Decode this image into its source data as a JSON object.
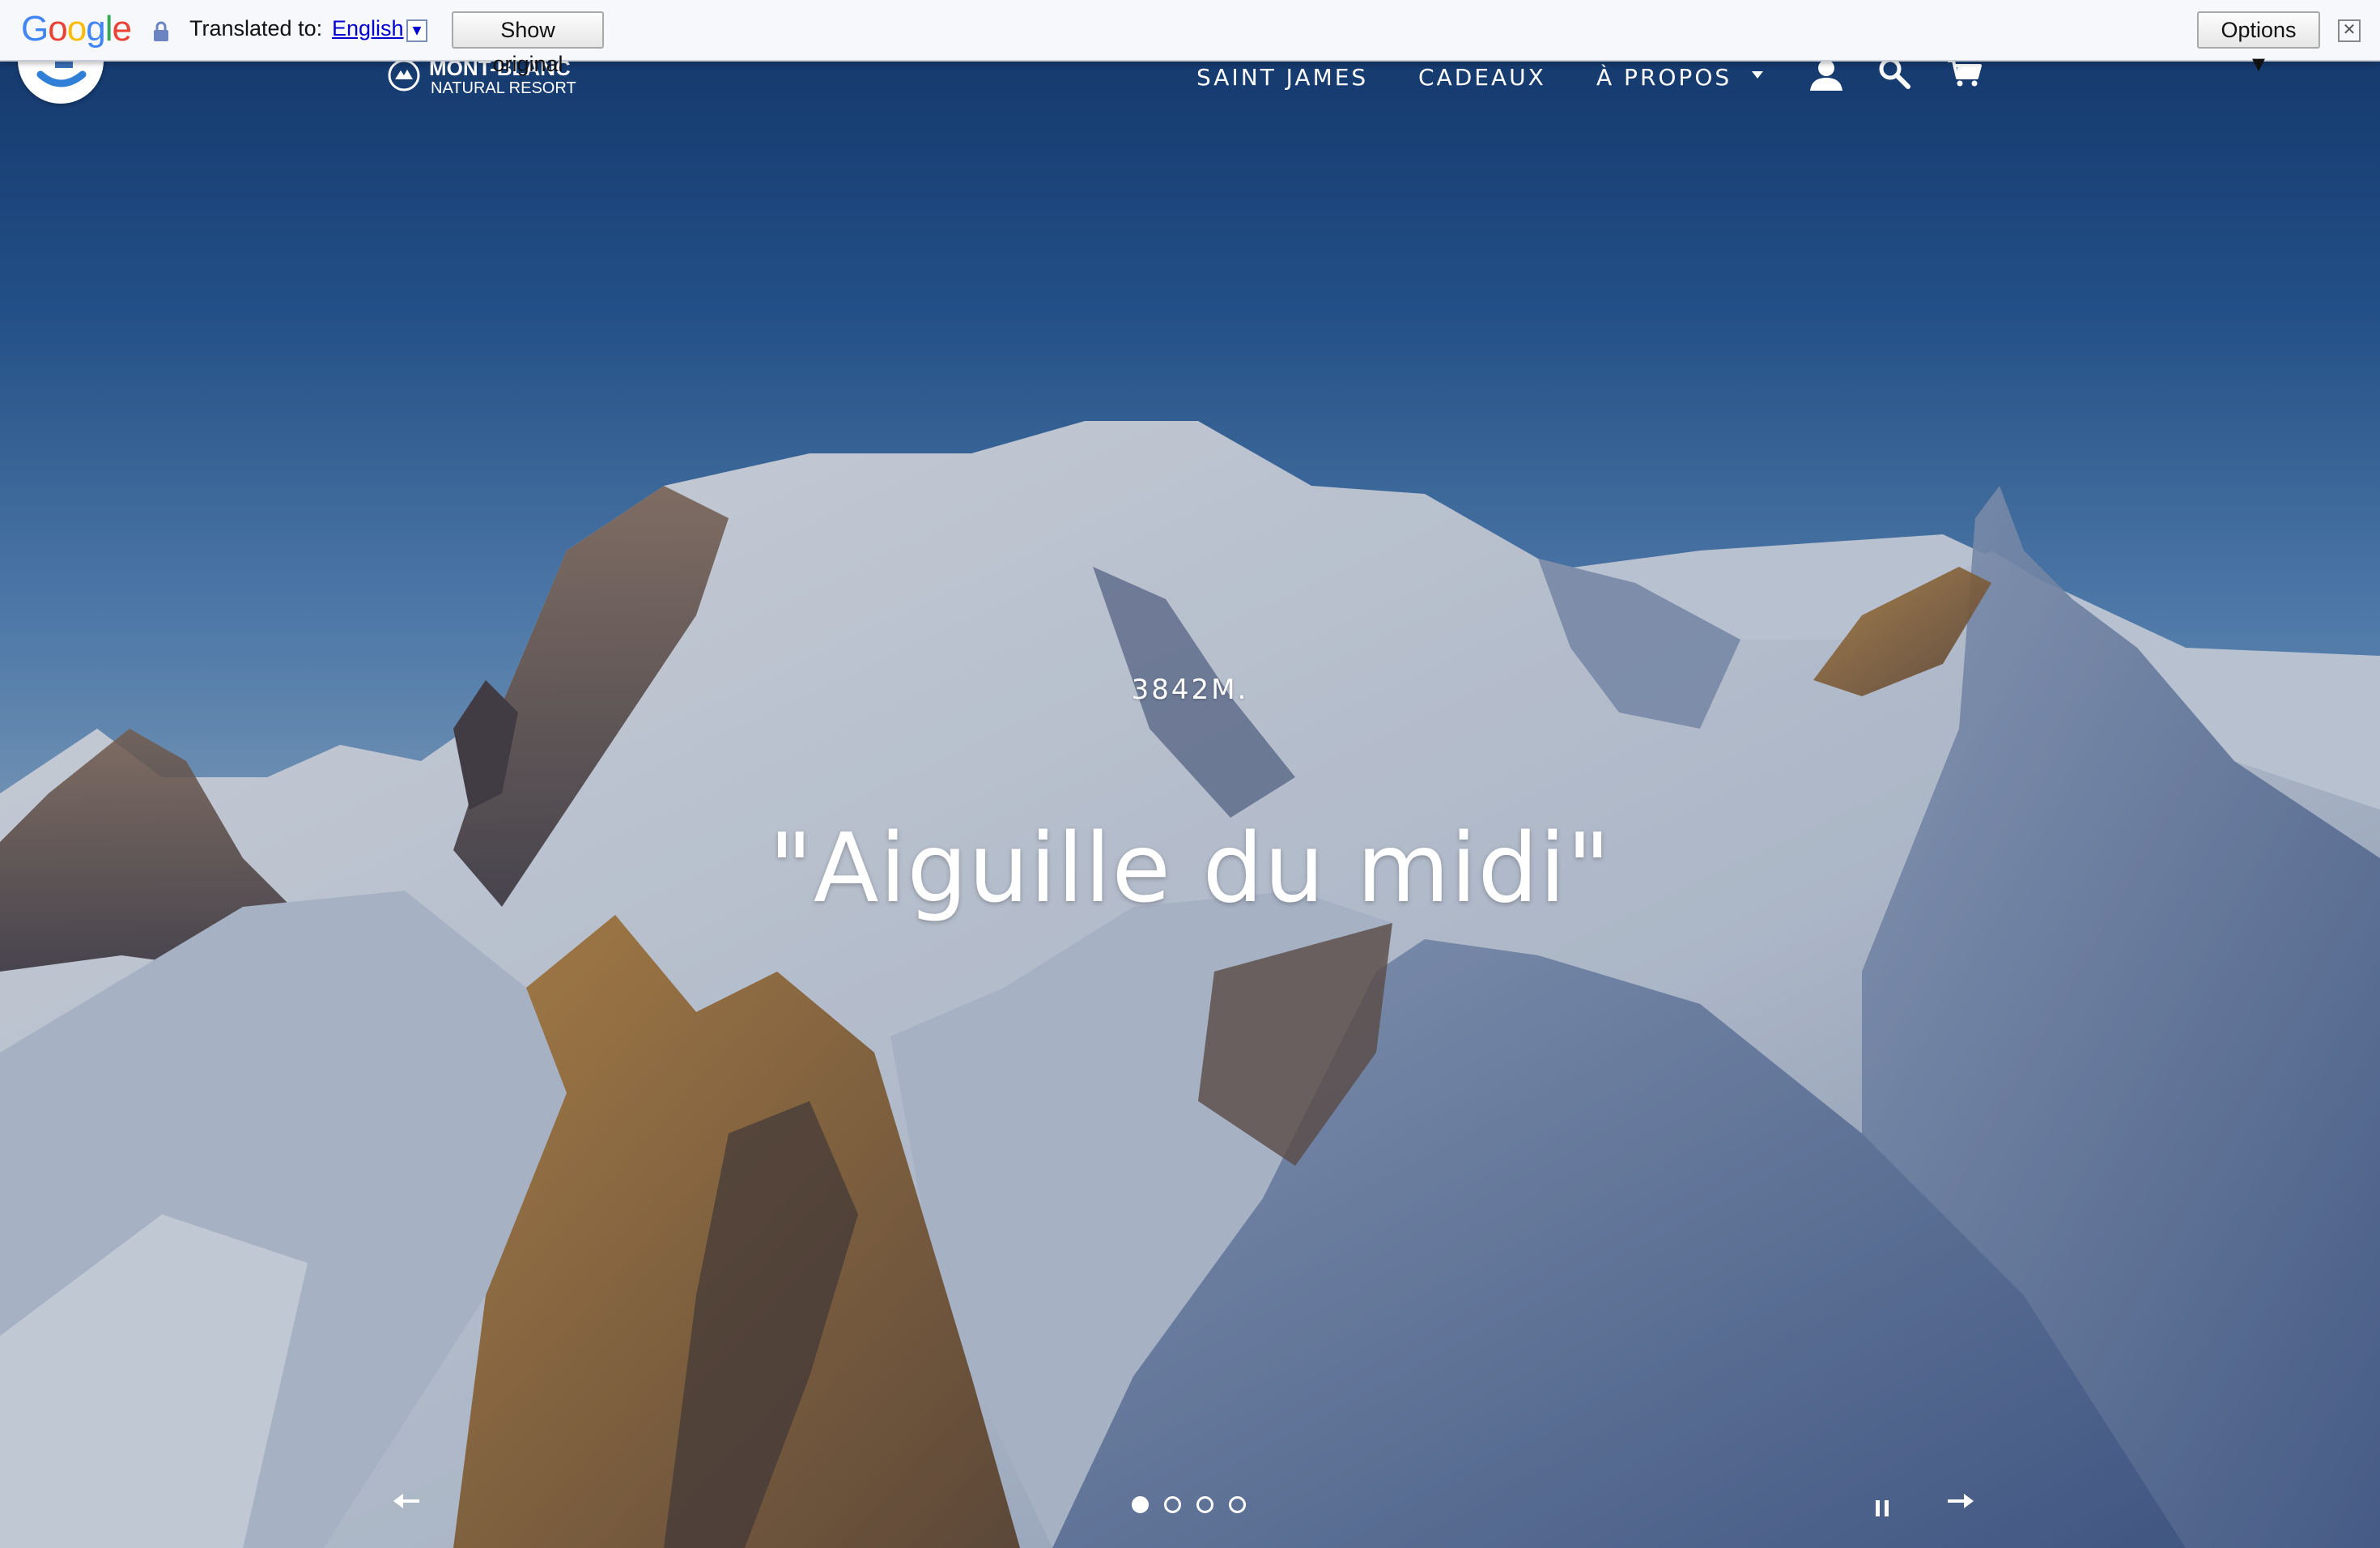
{
  "translate_bar": {
    "logo_text": "Google",
    "translated_to_label": "Translated to:",
    "language": "English",
    "language_dropdown_icon": "triangle-down-icon",
    "show_original_label": "Show original",
    "options_label": "Options ▼",
    "close_glyph": "✕",
    "lock_icon": "lock-icon"
  },
  "header": {
    "logo_line1": "MONT-BLANC",
    "logo_line2": "NATURAL RESORT",
    "nav": [
      {
        "label": "SAINT JAMES"
      },
      {
        "label": "CADEAUX"
      },
      {
        "label": "À PROPOS"
      }
    ],
    "icons": [
      "user-icon",
      "search-icon",
      "cart-icon"
    ]
  },
  "slide": {
    "subtitle": "3842M.",
    "title": "\"Aiguille du midi\"",
    "slide_count": 4,
    "active_slide": 1
  },
  "colors": {
    "translate_bar_bg": "#f6f8fc",
    "link_blue": "#0000cc",
    "header_text": "#ffffff"
  }
}
